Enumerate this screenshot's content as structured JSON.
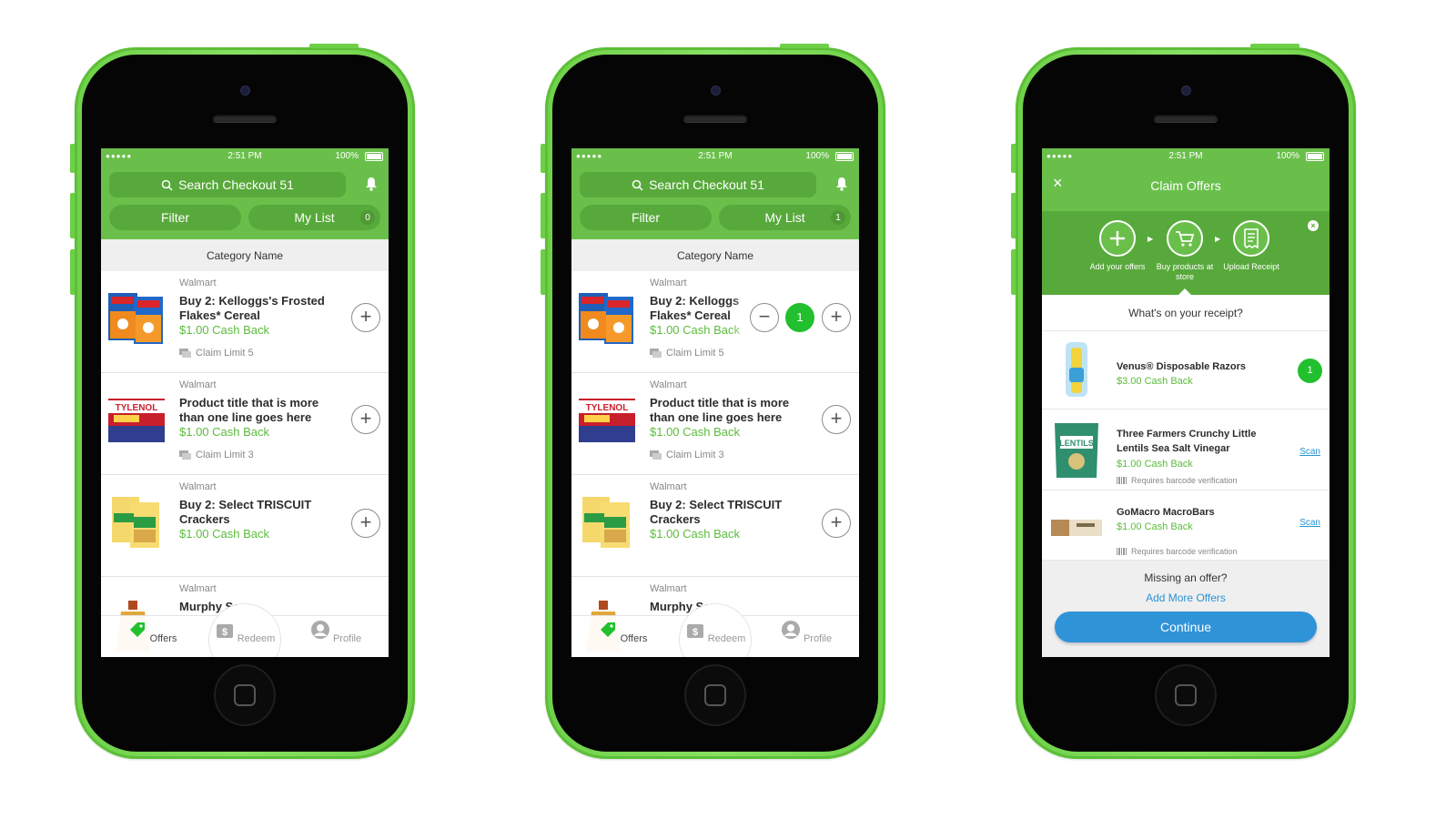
{
  "status": {
    "time": "2:51 PM",
    "battery": "100%"
  },
  "header": {
    "search_placeholder": "Search Checkout 51",
    "filter_label": "Filter",
    "mylist_label": "My List"
  },
  "category": "Category Name",
  "tabs": {
    "offers": "Offers",
    "redeem": "Redeem",
    "profile": "Profile"
  },
  "offers": [
    {
      "store": "Walmart",
      "title": "Buy 2: Kelloggs's Frosted Flakes* Cereal",
      "title_partial": "Buy 2: Kelloggs Flakes* Cereal",
      "cash": "$1.00 Cash Back",
      "limit": "Claim Limit 5"
    },
    {
      "store": "Walmart",
      "title": "Product title that is more than one line goes here",
      "cash": "$1.00 Cash Back",
      "limit": "Claim Limit 3"
    },
    {
      "store": "Walmart",
      "title": "Buy 2: Select TRISCUIT Crackers",
      "cash": "$1.00 Cash Back"
    },
    {
      "store": "Walmart",
      "title": "Murphy Soap"
    }
  ],
  "phone1": {
    "mylist_count": "0"
  },
  "phone2": {
    "mylist_count": "1",
    "quantity": "1"
  },
  "claim": {
    "title": "Claim Offers",
    "close": "×",
    "step1": "Add your offers",
    "step2": "Buy products at store",
    "step3": "Upload Receipt",
    "question": "What's on your receipt?",
    "items": [
      {
        "title": "Venus® Disposable Razors",
        "cash": "$3.00 Cash Back",
        "count": "1"
      },
      {
        "title": "Three Farmers Crunchy Little Lentils Sea Salt Vinegar",
        "cash": "$1.00 Cash Back",
        "req": "Requires barcode verification",
        "action": "Scan"
      },
      {
        "title": "GoMacro MacroBars",
        "cash": "$1.00 Cash Back",
        "req": "Requires barcode verification",
        "action": "Scan"
      }
    ],
    "missing_q": "Missing an offer?",
    "missing_link": "Add More Offers",
    "continue": "Continue"
  },
  "colors": {
    "brand_green": "#6abf4b",
    "dark_green": "#58a93b",
    "cash_green": "#5cbb3d",
    "link_blue": "#2a93d5",
    "button_blue": "#2f93d8",
    "phone_shell": "#7ad654"
  },
  "icons": [
    "search-icon",
    "bell-icon",
    "plus-icon",
    "minus-icon",
    "claim-limit-icon",
    "tag-icon",
    "redeem-icon",
    "profile-icon",
    "close-icon",
    "cart-icon",
    "receipt-icon",
    "barcode-icon"
  ]
}
